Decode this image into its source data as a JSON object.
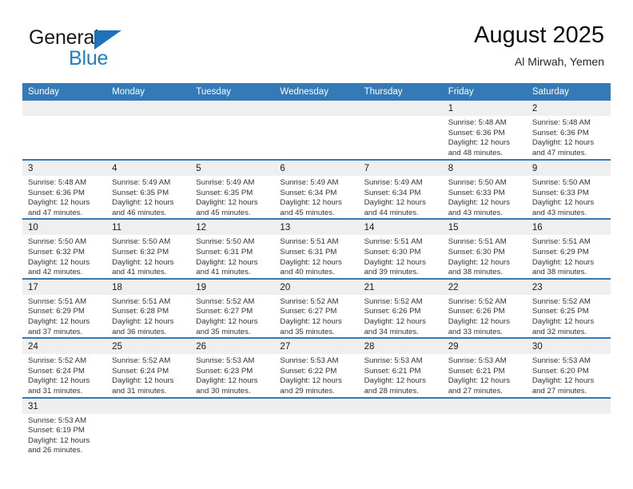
{
  "brand": {
    "name_top": "General",
    "name_bottom": "Blue",
    "flag_icon": "triangle-flag-icon",
    "color_dark": "#1b1b1b",
    "color_blue": "#1f7ec4"
  },
  "header": {
    "title": "August 2025",
    "subtitle": "Al Mirwah, Yemen"
  },
  "theme": {
    "header_bg": "#337ab7",
    "header_text": "#ffffff",
    "daynum_band_bg": "#efefef",
    "row_divider": "#337ab7",
    "body_text": "#333333"
  },
  "calendar": {
    "weekday_headers": [
      "Sunday",
      "Monday",
      "Tuesday",
      "Wednesday",
      "Thursday",
      "Friday",
      "Saturday"
    ],
    "weeks": [
      [
        {
          "day": "",
          "blank": true,
          "sunrise": "",
          "sunset": "",
          "daylight_line1": "",
          "daylight_line2": ""
        },
        {
          "day": "",
          "blank": true,
          "sunrise": "",
          "sunset": "",
          "daylight_line1": "",
          "daylight_line2": ""
        },
        {
          "day": "",
          "blank": true,
          "sunrise": "",
          "sunset": "",
          "daylight_line1": "",
          "daylight_line2": ""
        },
        {
          "day": "",
          "blank": true,
          "sunrise": "",
          "sunset": "",
          "daylight_line1": "",
          "daylight_line2": ""
        },
        {
          "day": "",
          "blank": true,
          "sunrise": "",
          "sunset": "",
          "daylight_line1": "",
          "daylight_line2": ""
        },
        {
          "day": "1",
          "blank": false,
          "sunrise": "Sunrise: 5:48 AM",
          "sunset": "Sunset: 6:36 PM",
          "daylight_line1": "Daylight: 12 hours",
          "daylight_line2": "and 48 minutes."
        },
        {
          "day": "2",
          "blank": false,
          "sunrise": "Sunrise: 5:48 AM",
          "sunset": "Sunset: 6:36 PM",
          "daylight_line1": "Daylight: 12 hours",
          "daylight_line2": "and 47 minutes."
        }
      ],
      [
        {
          "day": "3",
          "blank": false,
          "sunrise": "Sunrise: 5:48 AM",
          "sunset": "Sunset: 6:36 PM",
          "daylight_line1": "Daylight: 12 hours",
          "daylight_line2": "and 47 minutes."
        },
        {
          "day": "4",
          "blank": false,
          "sunrise": "Sunrise: 5:49 AM",
          "sunset": "Sunset: 6:35 PM",
          "daylight_line1": "Daylight: 12 hours",
          "daylight_line2": "and 46 minutes."
        },
        {
          "day": "5",
          "blank": false,
          "sunrise": "Sunrise: 5:49 AM",
          "sunset": "Sunset: 6:35 PM",
          "daylight_line1": "Daylight: 12 hours",
          "daylight_line2": "and 45 minutes."
        },
        {
          "day": "6",
          "blank": false,
          "sunrise": "Sunrise: 5:49 AM",
          "sunset": "Sunset: 6:34 PM",
          "daylight_line1": "Daylight: 12 hours",
          "daylight_line2": "and 45 minutes."
        },
        {
          "day": "7",
          "blank": false,
          "sunrise": "Sunrise: 5:49 AM",
          "sunset": "Sunset: 6:34 PM",
          "daylight_line1": "Daylight: 12 hours",
          "daylight_line2": "and 44 minutes."
        },
        {
          "day": "8",
          "blank": false,
          "sunrise": "Sunrise: 5:50 AM",
          "sunset": "Sunset: 6:33 PM",
          "daylight_line1": "Daylight: 12 hours",
          "daylight_line2": "and 43 minutes."
        },
        {
          "day": "9",
          "blank": false,
          "sunrise": "Sunrise: 5:50 AM",
          "sunset": "Sunset: 6:33 PM",
          "daylight_line1": "Daylight: 12 hours",
          "daylight_line2": "and 43 minutes."
        }
      ],
      [
        {
          "day": "10",
          "blank": false,
          "sunrise": "Sunrise: 5:50 AM",
          "sunset": "Sunset: 6:32 PM",
          "daylight_line1": "Daylight: 12 hours",
          "daylight_line2": "and 42 minutes."
        },
        {
          "day": "11",
          "blank": false,
          "sunrise": "Sunrise: 5:50 AM",
          "sunset": "Sunset: 6:32 PM",
          "daylight_line1": "Daylight: 12 hours",
          "daylight_line2": "and 41 minutes."
        },
        {
          "day": "12",
          "blank": false,
          "sunrise": "Sunrise: 5:50 AM",
          "sunset": "Sunset: 6:31 PM",
          "daylight_line1": "Daylight: 12 hours",
          "daylight_line2": "and 41 minutes."
        },
        {
          "day": "13",
          "blank": false,
          "sunrise": "Sunrise: 5:51 AM",
          "sunset": "Sunset: 6:31 PM",
          "daylight_line1": "Daylight: 12 hours",
          "daylight_line2": "and 40 minutes."
        },
        {
          "day": "14",
          "blank": false,
          "sunrise": "Sunrise: 5:51 AM",
          "sunset": "Sunset: 6:30 PM",
          "daylight_line1": "Daylight: 12 hours",
          "daylight_line2": "and 39 minutes."
        },
        {
          "day": "15",
          "blank": false,
          "sunrise": "Sunrise: 5:51 AM",
          "sunset": "Sunset: 6:30 PM",
          "daylight_line1": "Daylight: 12 hours",
          "daylight_line2": "and 38 minutes."
        },
        {
          "day": "16",
          "blank": false,
          "sunrise": "Sunrise: 5:51 AM",
          "sunset": "Sunset: 6:29 PM",
          "daylight_line1": "Daylight: 12 hours",
          "daylight_line2": "and 38 minutes."
        }
      ],
      [
        {
          "day": "17",
          "blank": false,
          "sunrise": "Sunrise: 5:51 AM",
          "sunset": "Sunset: 6:29 PM",
          "daylight_line1": "Daylight: 12 hours",
          "daylight_line2": "and 37 minutes."
        },
        {
          "day": "18",
          "blank": false,
          "sunrise": "Sunrise: 5:51 AM",
          "sunset": "Sunset: 6:28 PM",
          "daylight_line1": "Daylight: 12 hours",
          "daylight_line2": "and 36 minutes."
        },
        {
          "day": "19",
          "blank": false,
          "sunrise": "Sunrise: 5:52 AM",
          "sunset": "Sunset: 6:27 PM",
          "daylight_line1": "Daylight: 12 hours",
          "daylight_line2": "and 35 minutes."
        },
        {
          "day": "20",
          "blank": false,
          "sunrise": "Sunrise: 5:52 AM",
          "sunset": "Sunset: 6:27 PM",
          "daylight_line1": "Daylight: 12 hours",
          "daylight_line2": "and 35 minutes."
        },
        {
          "day": "21",
          "blank": false,
          "sunrise": "Sunrise: 5:52 AM",
          "sunset": "Sunset: 6:26 PM",
          "daylight_line1": "Daylight: 12 hours",
          "daylight_line2": "and 34 minutes."
        },
        {
          "day": "22",
          "blank": false,
          "sunrise": "Sunrise: 5:52 AM",
          "sunset": "Sunset: 6:26 PM",
          "daylight_line1": "Daylight: 12 hours",
          "daylight_line2": "and 33 minutes."
        },
        {
          "day": "23",
          "blank": false,
          "sunrise": "Sunrise: 5:52 AM",
          "sunset": "Sunset: 6:25 PM",
          "daylight_line1": "Daylight: 12 hours",
          "daylight_line2": "and 32 minutes."
        }
      ],
      [
        {
          "day": "24",
          "blank": false,
          "sunrise": "Sunrise: 5:52 AM",
          "sunset": "Sunset: 6:24 PM",
          "daylight_line1": "Daylight: 12 hours",
          "daylight_line2": "and 31 minutes."
        },
        {
          "day": "25",
          "blank": false,
          "sunrise": "Sunrise: 5:52 AM",
          "sunset": "Sunset: 6:24 PM",
          "daylight_line1": "Daylight: 12 hours",
          "daylight_line2": "and 31 minutes."
        },
        {
          "day": "26",
          "blank": false,
          "sunrise": "Sunrise: 5:53 AM",
          "sunset": "Sunset: 6:23 PM",
          "daylight_line1": "Daylight: 12 hours",
          "daylight_line2": "and 30 minutes."
        },
        {
          "day": "27",
          "blank": false,
          "sunrise": "Sunrise: 5:53 AM",
          "sunset": "Sunset: 6:22 PM",
          "daylight_line1": "Daylight: 12 hours",
          "daylight_line2": "and 29 minutes."
        },
        {
          "day": "28",
          "blank": false,
          "sunrise": "Sunrise: 5:53 AM",
          "sunset": "Sunset: 6:21 PM",
          "daylight_line1": "Daylight: 12 hours",
          "daylight_line2": "and 28 minutes."
        },
        {
          "day": "29",
          "blank": false,
          "sunrise": "Sunrise: 5:53 AM",
          "sunset": "Sunset: 6:21 PM",
          "daylight_line1": "Daylight: 12 hours",
          "daylight_line2": "and 27 minutes."
        },
        {
          "day": "30",
          "blank": false,
          "sunrise": "Sunrise: 5:53 AM",
          "sunset": "Sunset: 6:20 PM",
          "daylight_line1": "Daylight: 12 hours",
          "daylight_line2": "and 27 minutes."
        }
      ],
      [
        {
          "day": "31",
          "blank": false,
          "sunrise": "Sunrise: 5:53 AM",
          "sunset": "Sunset: 6:19 PM",
          "daylight_line1": "Daylight: 12 hours",
          "daylight_line2": "and 26 minutes."
        },
        {
          "day": "",
          "blank": true,
          "sunrise": "",
          "sunset": "",
          "daylight_line1": "",
          "daylight_line2": ""
        },
        {
          "day": "",
          "blank": true,
          "sunrise": "",
          "sunset": "",
          "daylight_line1": "",
          "daylight_line2": ""
        },
        {
          "day": "",
          "blank": true,
          "sunrise": "",
          "sunset": "",
          "daylight_line1": "",
          "daylight_line2": ""
        },
        {
          "day": "",
          "blank": true,
          "sunrise": "",
          "sunset": "",
          "daylight_line1": "",
          "daylight_line2": ""
        },
        {
          "day": "",
          "blank": true,
          "sunrise": "",
          "sunset": "",
          "daylight_line1": "",
          "daylight_line2": ""
        },
        {
          "day": "",
          "blank": true,
          "sunrise": "",
          "sunset": "",
          "daylight_line1": "",
          "daylight_line2": ""
        }
      ]
    ]
  }
}
